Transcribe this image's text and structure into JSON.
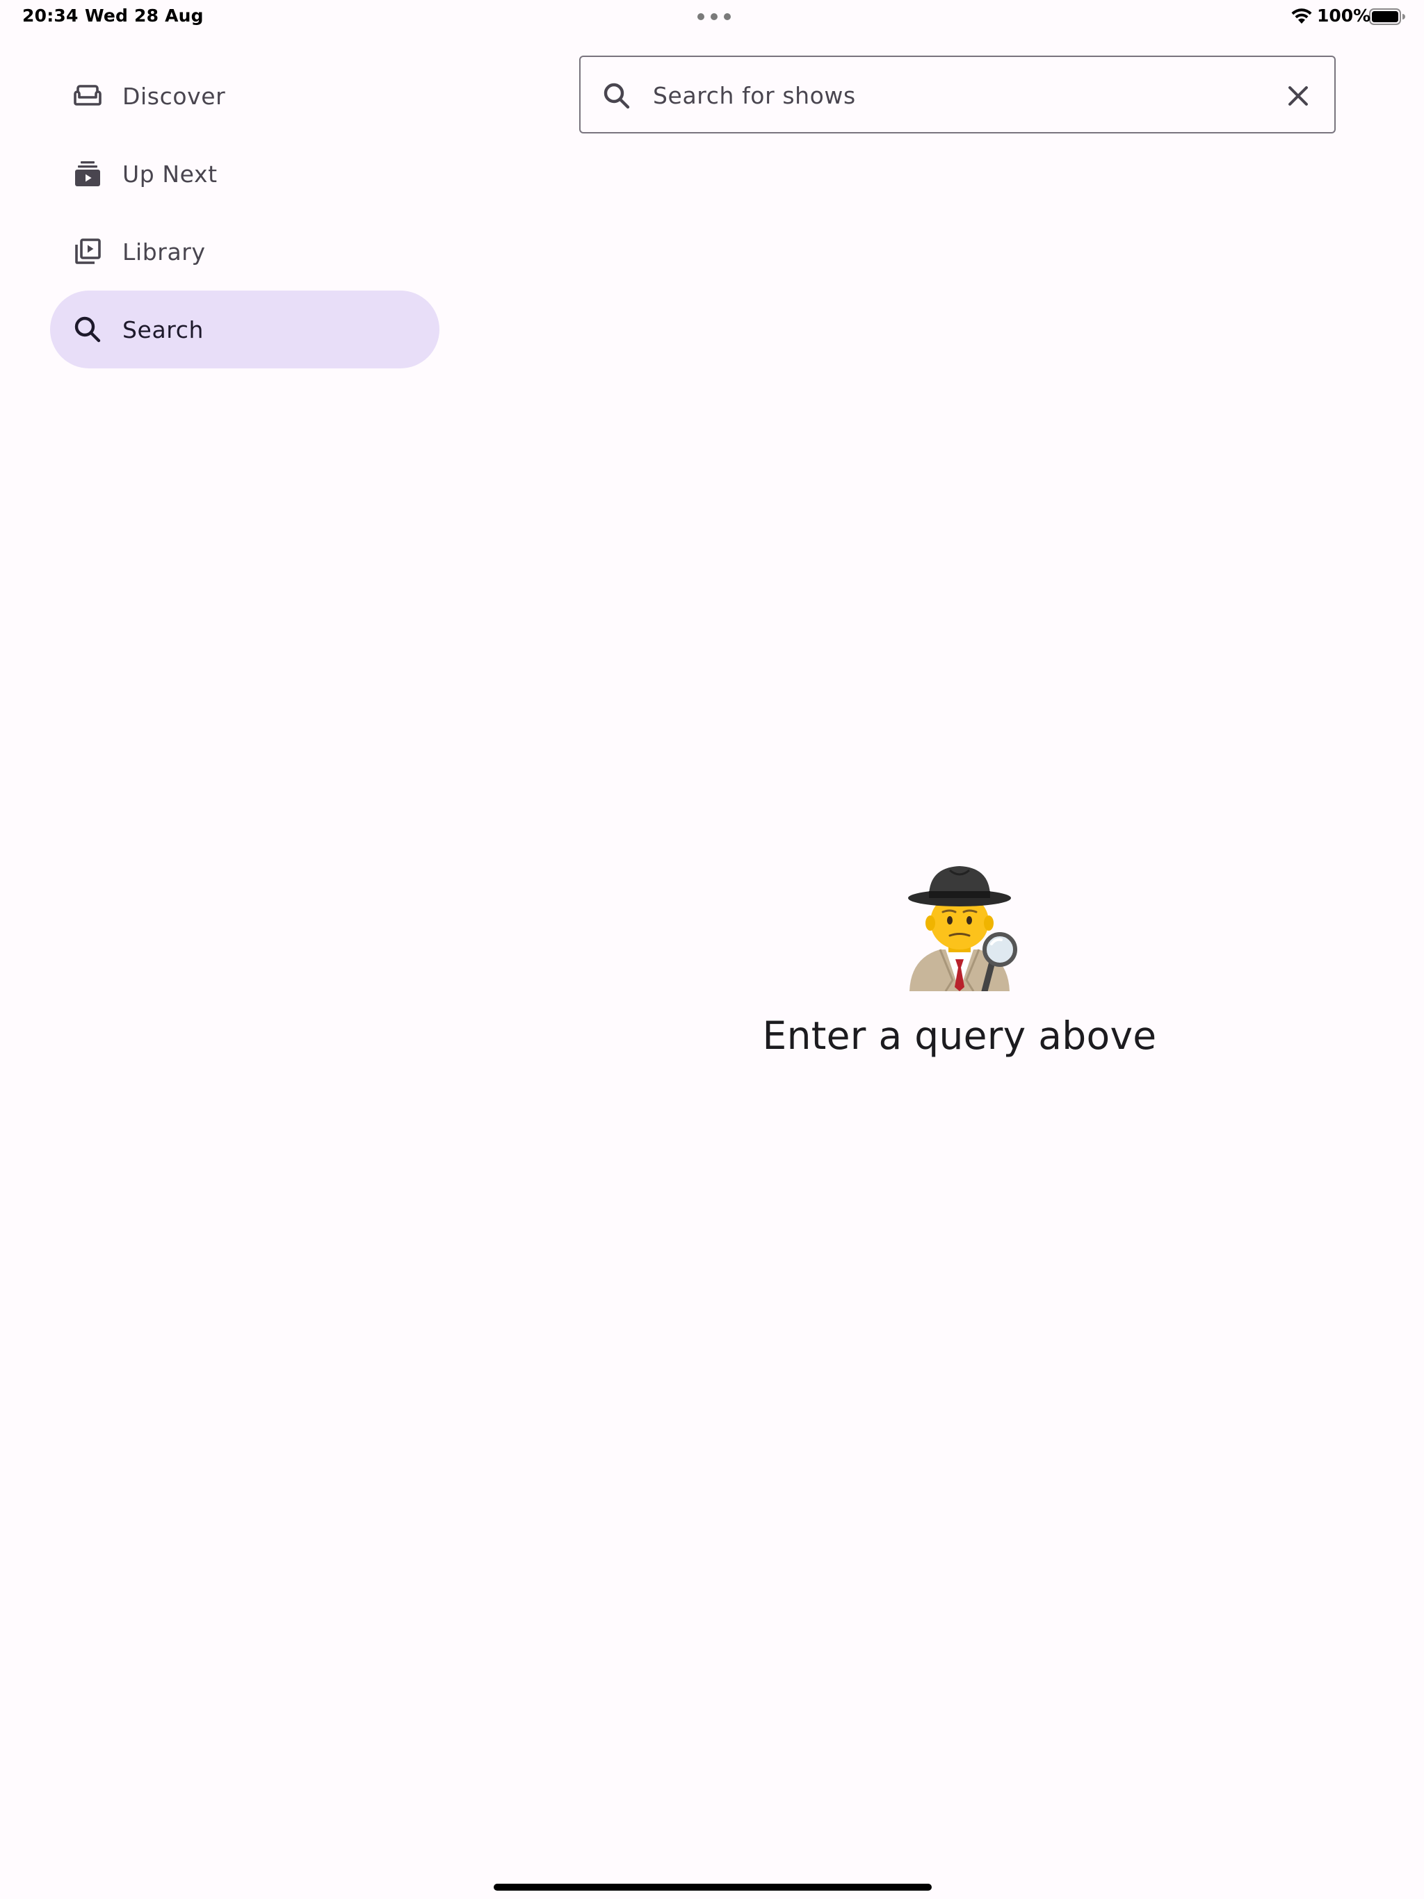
{
  "status_bar": {
    "time": "20:34",
    "date": "Wed 28 Aug",
    "battery": "100%",
    "icons": [
      "wifi-icon",
      "battery-icon",
      "multitask-dots-icon"
    ]
  },
  "nav": {
    "items": [
      {
        "label": "Discover",
        "icon": "couch-icon",
        "active": false
      },
      {
        "label": "Up Next",
        "icon": "playlist-play-icon",
        "active": false
      },
      {
        "label": "Library",
        "icon": "video-library-icon",
        "active": false
      },
      {
        "label": "Search",
        "icon": "search-icon",
        "active": true
      }
    ]
  },
  "search": {
    "placeholder": "Search for shows",
    "value": "",
    "leading_icon": "search-icon",
    "trailing_icon": "close-icon"
  },
  "empty_state": {
    "icon": "detective-emoji-icon",
    "message": "Enter a query above"
  },
  "colors": {
    "background": "#fffbfe",
    "active_indicator": "#e8def8",
    "icon": "#49454f",
    "outline": "#79747e"
  }
}
